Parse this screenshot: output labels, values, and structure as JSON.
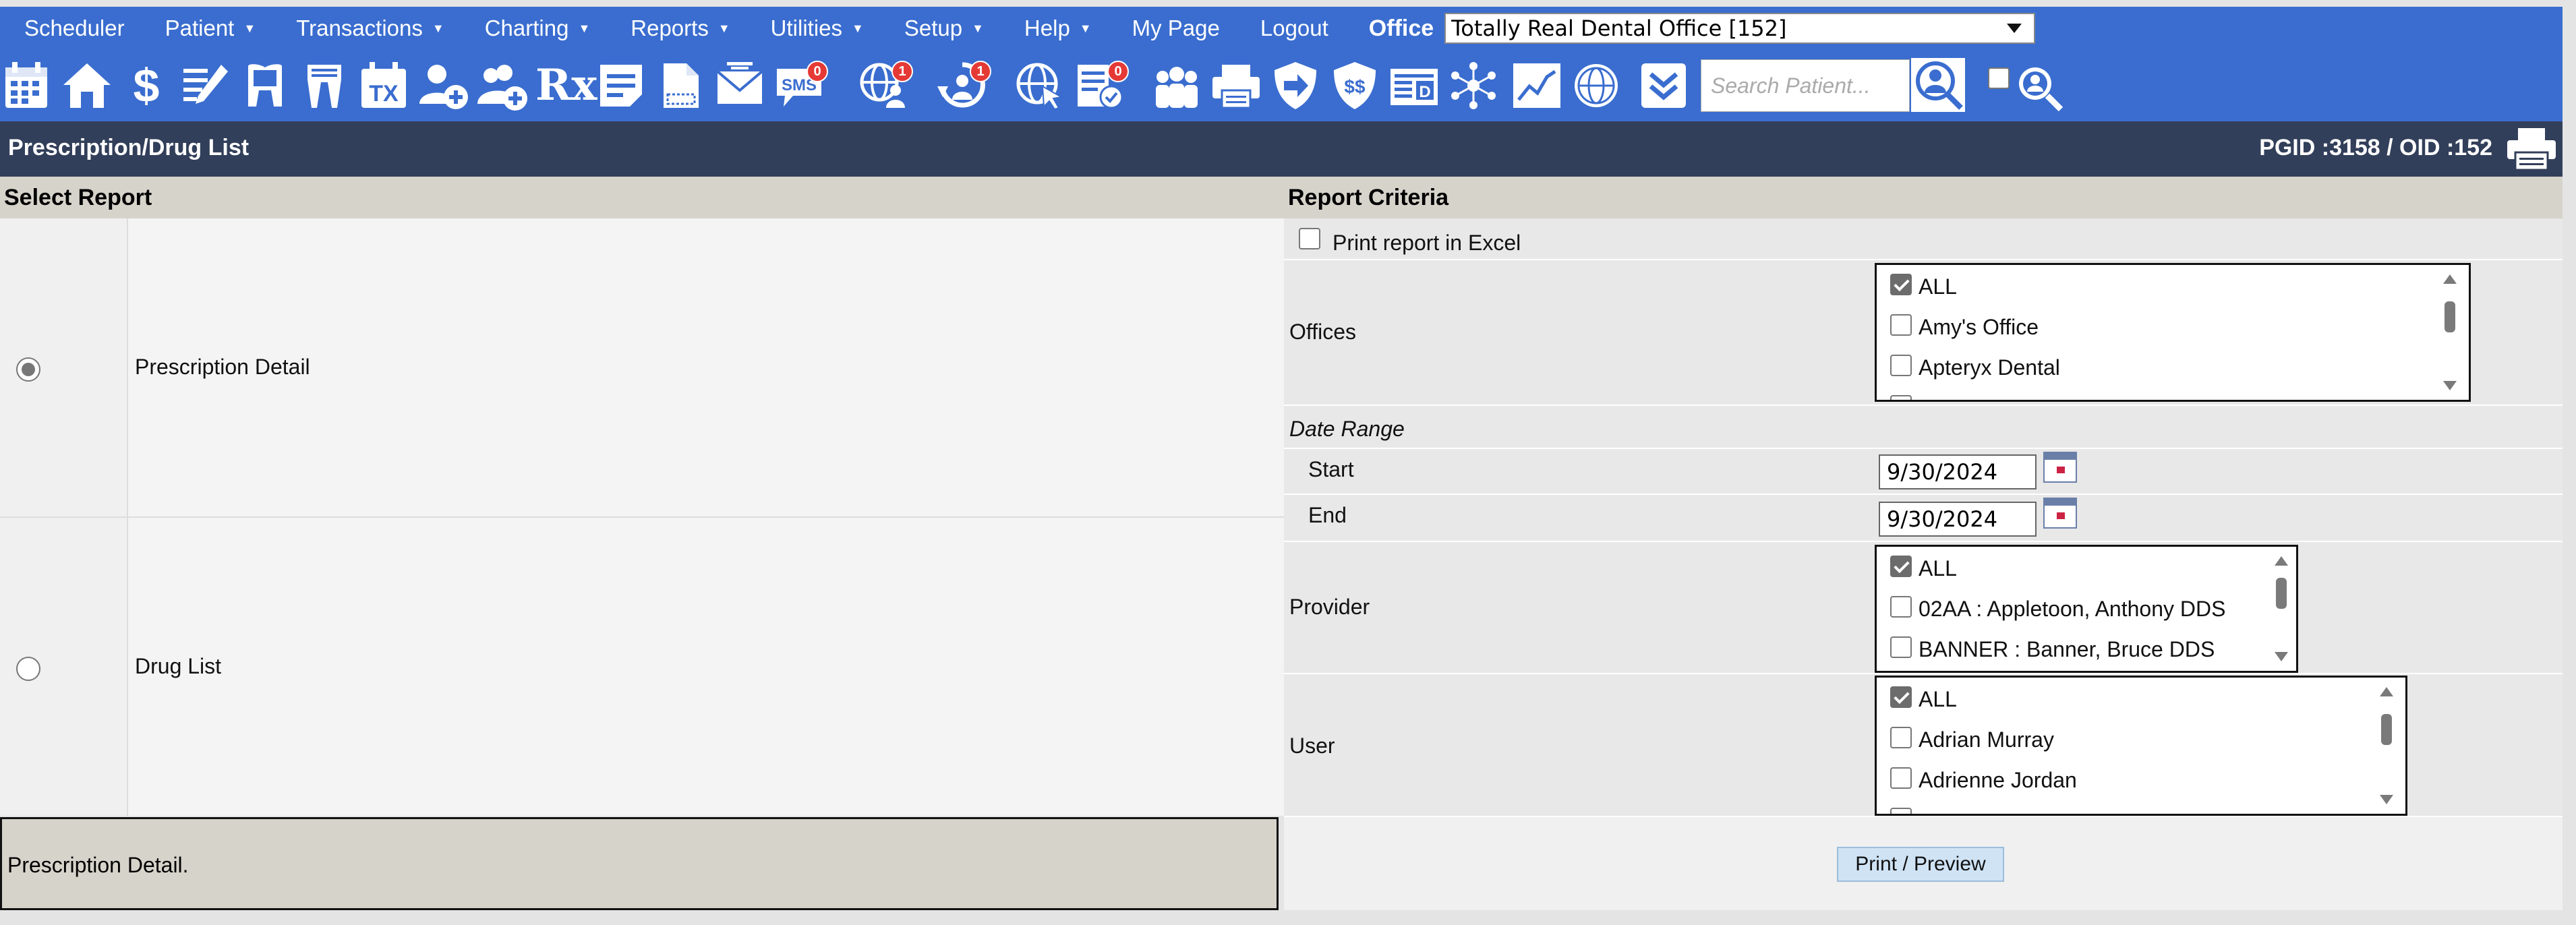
{
  "menu": {
    "items": [
      {
        "label": "Scheduler",
        "caret": false
      },
      {
        "label": "Patient",
        "caret": true
      },
      {
        "label": "Transactions",
        "caret": true
      },
      {
        "label": "Charting",
        "caret": true
      },
      {
        "label": "Reports",
        "caret": true
      },
      {
        "label": "Utilities",
        "caret": true
      },
      {
        "label": "Setup",
        "caret": true
      },
      {
        "label": "Help",
        "caret": true
      },
      {
        "label": "My Page",
        "caret": false
      },
      {
        "label": "Logout",
        "caret": false
      }
    ],
    "caret_glyph": "▼",
    "office_label": "Office",
    "office_value": "Totally Real Dental Office [152]"
  },
  "toolbar": {
    "icons": [
      "calendar-icon",
      "home-icon",
      "dollar-icon",
      "chart-edit-icon",
      "tooth-icon",
      "tooth-roots-icon",
      "treatment-tx-icon",
      "add-patient-icon",
      "add-family-icon",
      "rx-icon",
      "notes-icon",
      "document-icon",
      "mail-icon",
      "sms-icon",
      "web-patient-icon",
      "recall-icon",
      "web-click-icon",
      "forms-icon",
      "family-icon",
      "printer-icon",
      "forward-icon",
      "insurance-shield-icon",
      "money-exchange-icon",
      "daysheet-icon",
      "network-icon",
      "line-chart-icon",
      "globe-person-icon",
      "collapse-down-icon"
    ],
    "tx_label": "TX",
    "rx_label": "Rx",
    "sms_label": "SMS",
    "d_label": "D",
    "sms_badge": "0",
    "web_badge": "1",
    "recall_badge": "1",
    "forms_badge": "0",
    "search_placeholder": "Search Patient..."
  },
  "title": {
    "page": "Prescription/Drug List",
    "ids": "PGID :3158  /  OID :152"
  },
  "select_report": {
    "header": "Select Report",
    "options": [
      {
        "label": "Prescription Detail",
        "selected": true
      },
      {
        "label": "Drug List",
        "selected": false
      }
    ],
    "description": "Prescription Detail."
  },
  "criteria": {
    "header": "Report Criteria",
    "excel_label": "Print report in Excel",
    "offices_label": "Offices",
    "offices": [
      {
        "label": "ALL",
        "checked": true
      },
      {
        "label": "Amy's Office",
        "checked": false
      },
      {
        "label": "Apteryx Dental",
        "checked": false
      }
    ],
    "date_range_label": "Date Range",
    "start_label": "Start",
    "start_value": "9/30/2024",
    "end_label": "End",
    "end_value": "9/30/2024",
    "provider_label": "Provider",
    "providers": [
      {
        "label": "ALL",
        "checked": true
      },
      {
        "label": "02AA : Appletoon, Anthony DDS",
        "checked": false
      },
      {
        "label": "BANNER : Banner, Bruce DDS",
        "checked": false
      }
    ],
    "user_label": "User",
    "users": [
      {
        "label": "ALL",
        "checked": true
      },
      {
        "label": "Adrian Murray",
        "checked": false
      },
      {
        "label": "Adrienne Jordan",
        "checked": false
      }
    ],
    "print_button": "Print / Preview"
  }
}
